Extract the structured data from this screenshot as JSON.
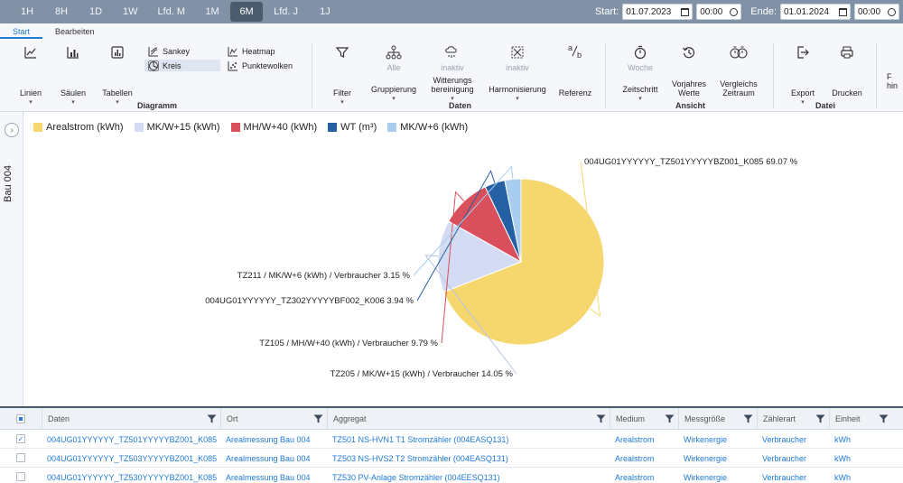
{
  "topbar": {
    "ranges": [
      "1H",
      "8H",
      "1D",
      "1W",
      "Lfd. M",
      "1M",
      "6M",
      "Lfd. J",
      "1J"
    ],
    "active_range": "6M",
    "start_label": "Start:",
    "start_date": "01.07.2023",
    "start_time": "00:00",
    "end_label": "Ende:",
    "end_date": "01.01.2024",
    "end_time": "00:00"
  },
  "ribbon": {
    "tabs": [
      "Start",
      "Bearbeiten"
    ],
    "active_tab": "Start",
    "diagramm": {
      "label": "Diagramm",
      "linien": "Linien",
      "saeulen": "Säulen",
      "tabellen": "Tabellen",
      "sankey": "Sankey",
      "kreis": "Kreis",
      "heatmap": "Heatmap",
      "punktewolken": "Punktewolken"
    },
    "daten": {
      "label": "Daten",
      "filter": "Filter",
      "gruppierung": "Gruppierung",
      "gruppierung_sub": "Alle",
      "witterung_1": "Witterungs",
      "witterung_2": "bereinigung",
      "witterung_sub": "inaktiv",
      "harmonisierung": "Harmonisierung",
      "harmonisierung_sub": "inaktiv",
      "referenz": "Referenz"
    },
    "ansicht": {
      "label": "Ansicht",
      "zeitschritt": "Zeitschritt",
      "zeitschritt_sub": "Woche",
      "vorjahres_1": "Vorjahres",
      "vorjahres_2": "Werte",
      "vergleich_1": "Vergleichs",
      "vergleich_2": "Zeitraum"
    },
    "datei": {
      "label": "Datei",
      "export": "Export",
      "drucken": "Drucken"
    },
    "cut_1": "F",
    "cut_2": "hin"
  },
  "sidebar": {
    "title": "Bau 004"
  },
  "chart_data": {
    "type": "pie",
    "legend": [
      {
        "name": "Arealstrom (kWh)",
        "color": "#f5d76e"
      },
      {
        "name": "MK/W+15 (kWh)",
        "color": "#d3dcf2"
      },
      {
        "name": "MH/W+40 (kWh)",
        "color": "#d94f5c"
      },
      {
        "name": "WT (m³)",
        "color": "#2660a4"
      },
      {
        "name": "MK/W+6 (kWh)",
        "color": "#a8cdee"
      }
    ],
    "slices": [
      {
        "label": "004UG01YYYYYY_TZ501YYYYYBZ001_K085 69.07 %",
        "value": 69.07,
        "color": "#f5d76e"
      },
      {
        "label": "TZ205 / MK/W+15 (kWh) / Verbraucher 14.05 %",
        "value": 14.05,
        "color": "#d3dcf2"
      },
      {
        "label": "TZ105 / MH/W+40 (kWh) / Verbraucher 9.79 %",
        "value": 9.79,
        "color": "#d94f5c"
      },
      {
        "label": "004UG01YYYYYY_TZ302YYYYYBF002_K006 3.94 %",
        "value": 3.94,
        "color": "#2660a4"
      },
      {
        "label": "TZ211 / MK/W+6 (kWh) / Verbraucher 3.15 %",
        "value": 3.15,
        "color": "#a8cdee"
      }
    ]
  },
  "table": {
    "headers": [
      "Daten",
      "Ort",
      "Aggregat",
      "Medium",
      "Messgröße",
      "Zählerart",
      "Einheit"
    ],
    "rows": [
      {
        "checked": true,
        "daten": "004UG01YYYYYY_TZ501YYYYYBZ001_K085",
        "ort": "Arealmessung Bau 004",
        "aggregat": "TZ501 NS-HVN1 T1 Stromzähler (004EASQ131)",
        "medium": "Arealstrom",
        "messgroesse": "Wirkenergie",
        "zaehlerart": "Verbraucher",
        "einheit": "kWh"
      },
      {
        "checked": false,
        "daten": "004UG01YYYYYY_TZ503YYYYYBZ001_K085",
        "ort": "Arealmessung Bau 004",
        "aggregat": "TZ503 NS-HVS2 T2 Stromzähler (004EASQ131)",
        "medium": "Arealstrom",
        "messgroesse": "Wirkenergie",
        "zaehlerart": "Verbraucher",
        "einheit": "kWh"
      },
      {
        "checked": false,
        "daten": "004UG01YYYYYY_TZ530YYYYYBZ001_K085",
        "ort": "Arealmessung Bau 004",
        "aggregat": "TZ530 PV-Anlage Stromzähler (004EESQ131)",
        "medium": "Arealstrom",
        "messgroesse": "Wirkenergie",
        "zaehlerart": "Verbraucher",
        "einheit": "kWh"
      }
    ]
  }
}
